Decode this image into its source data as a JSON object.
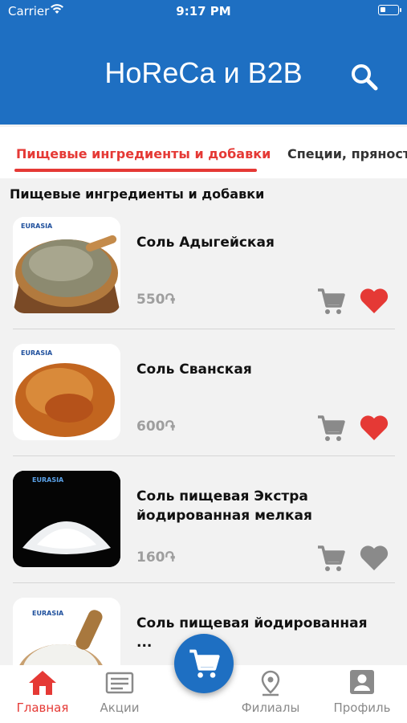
{
  "status_bar": {
    "carrier": "Carrier",
    "time": "9:17 PM"
  },
  "header": {
    "title": "HoReCa и B2B"
  },
  "tabs": [
    {
      "label": "Пищевые ингредиенты и добавки",
      "active": true
    },
    {
      "label": "Специи, пряности",
      "active": false
    }
  ],
  "section": {
    "title": "Пищевые ингредиенты и добавки"
  },
  "products": [
    {
      "name": "Соль Адыгейская",
      "price": "550֏",
      "favorite": true,
      "thumb_brand": "EURASIA"
    },
    {
      "name": "Соль Сванская",
      "price": "600֏",
      "favorite": true,
      "thumb_brand": "EURASIA"
    },
    {
      "name": "Соль пищевая Экстра йодированная мелкая",
      "price": "160֏",
      "favorite": false,
      "thumb_brand": "EURASIA"
    },
    {
      "name": "Соль пищевая йодированная ...",
      "price": "",
      "favorite": false,
      "thumb_brand": "EURASIA"
    }
  ],
  "bottom_nav": [
    {
      "label": "Главная",
      "icon": "home-icon",
      "active": true
    },
    {
      "label": "Акции",
      "icon": "promo-icon",
      "active": false
    },
    {
      "label": "Филиалы",
      "icon": "location-icon",
      "active": false
    },
    {
      "label": "Профиль",
      "icon": "profile-icon",
      "active": false
    }
  ],
  "colors": {
    "primary": "#1e6fc2",
    "accent": "#e53935",
    "muted": "#9e9e9e"
  }
}
